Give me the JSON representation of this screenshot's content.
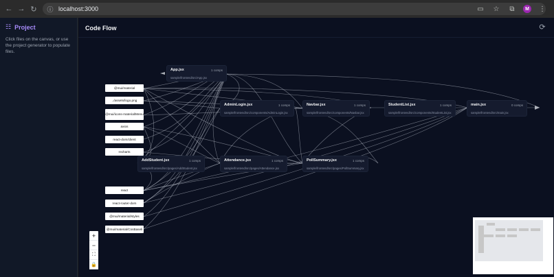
{
  "browser": {
    "url": "localhost:3000",
    "avatar_letter": "M"
  },
  "sidebar": {
    "title": "Project",
    "help": "Click files on the canvas, or use the project generator to populate files."
  },
  "header": {
    "title": "Code Flow"
  },
  "nodes": {
    "app": {
      "title": "App.jsx",
      "count": "1 comps",
      "path": "sample/frontend/src/App.jsx"
    },
    "adminlogin": {
      "title": "AdminLogin.jsx",
      "count": "1 comps",
      "path": "sample/frontend/src/components/AdminLogin.jsx"
    },
    "navbar": {
      "title": "Navbar.jsx",
      "count": "1 comps",
      "path": "sample/frontend/src/components/Navbar.jsx"
    },
    "studentlist": {
      "title": "StudentList.jsx",
      "count": "1 comps",
      "path": "sample/frontend/src/components/StudentList.jsx"
    },
    "main": {
      "title": "main.jsx",
      "count": "0 comps",
      "path": "sample/frontend/src/main.jsx"
    },
    "addstudent": {
      "title": "AddStudent.jsx",
      "count": "1 comps",
      "path": "sample/frontend/src/pages/AddStudent.jsx"
    },
    "attendance": {
      "title": "Attendance.jsx",
      "count": "1 comps",
      "path": "sample/frontend/src/pages/Attendance.jsx"
    },
    "pollsummary": {
      "title": "PollSummary.jsx",
      "count": "1 comps",
      "path": "sample/frontend/src/pages/PollSummary.jsx"
    }
  },
  "deps": [
    "@mui/material",
    "../assets/logo.png",
    "@mui/icons-material/Menu",
    "axios",
    "react-dom/client",
    "recharts",
    "react",
    "react-router-dom",
    "@mui/material/styles",
    "@mui/material/CssBaseli"
  ],
  "controls": {
    "zoom_in": "+",
    "zoom_out": "−",
    "fit": "⛶",
    "lock": "🔒"
  }
}
